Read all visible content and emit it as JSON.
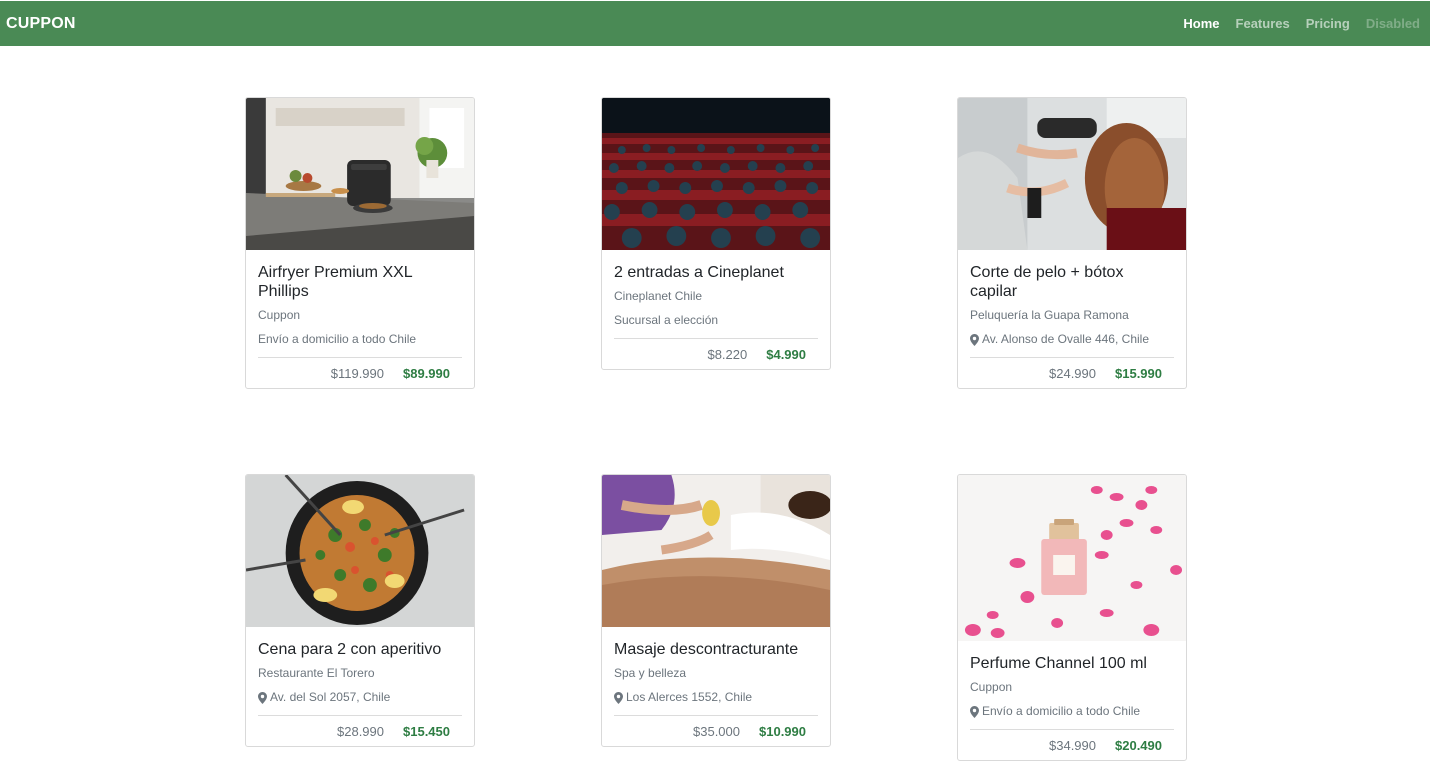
{
  "navbar": {
    "brand": "CUPPON",
    "links": [
      {
        "label": "Home",
        "state": "active"
      },
      {
        "label": "Features",
        "state": "normal"
      },
      {
        "label": "Pricing",
        "state": "normal"
      },
      {
        "label": "Disabled",
        "state": "disabled"
      }
    ]
  },
  "colors": {
    "navbar": "#4a8a55",
    "price_accent": "#2e7d43"
  },
  "cards": [
    {
      "title": "Airfryer Premium XXL Phillips",
      "seller": "Cuppon",
      "location": "Envío a domicilio a todo Chile",
      "location_icon": false,
      "old_price": "$119.990",
      "new_price": "$89.990",
      "image": "airfryer-kitchen"
    },
    {
      "title": "2 entradas a Cineplanet",
      "seller": "Cineplanet Chile",
      "location": "Sucursal a elección",
      "location_icon": false,
      "old_price": "$8.220",
      "new_price": "$4.990",
      "image": "cinema-audience"
    },
    {
      "title": "Corte de pelo + bótox capilar",
      "seller": "Peluquería la Guapa Ramona",
      "location": "Av. Alonso de Ovalle 446, Chile",
      "location_icon": true,
      "old_price": "$24.990",
      "new_price": "$15.990",
      "image": "hair-salon"
    },
    {
      "title": "Cena para 2 con aperitivo",
      "seller": "Restaurante El Torero",
      "location": "Av. del Sol 2057, Chile",
      "location_icon": true,
      "old_price": "$28.990",
      "new_price": "$15.450",
      "image": "paella-dish"
    },
    {
      "title": "Masaje descontracturante",
      "seller": "Spa y belleza",
      "location": "Los Alerces 1552, Chile",
      "location_icon": true,
      "old_price": "$35.000",
      "new_price": "$10.990",
      "image": "back-massage"
    },
    {
      "title": "Perfume Channel 100 ml",
      "seller": "Cuppon",
      "location": "Envío a domicilio a todo Chile",
      "location_icon": true,
      "old_price": "$34.990",
      "new_price": "$20.490",
      "image": "perfume-petals"
    }
  ]
}
